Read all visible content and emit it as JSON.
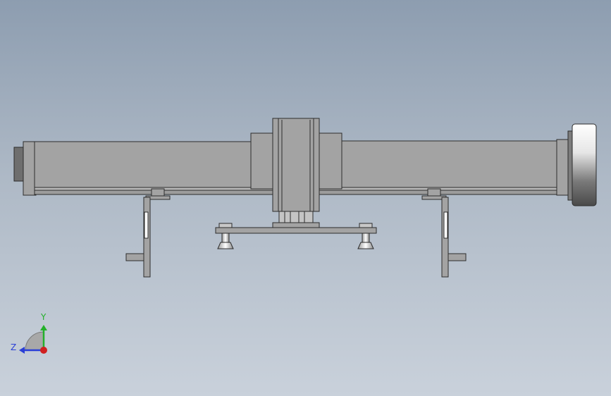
{
  "viewport": {
    "background_top": "#8d9db0",
    "background_bottom": "#c9d1db"
  },
  "model": {
    "parts": [
      "actuator-body",
      "motor-housing",
      "carriage",
      "mounting-plate",
      "suction-cup",
      "support-bracket",
      "handwheel"
    ],
    "base_color": "#a3a3a3",
    "edge_color": "#2c2c2c"
  },
  "triad": {
    "y_label": "Y",
    "z_label": "Z",
    "y_color": "#23b02a",
    "z_color": "#2a3fd6",
    "x_color": "#d02020"
  }
}
